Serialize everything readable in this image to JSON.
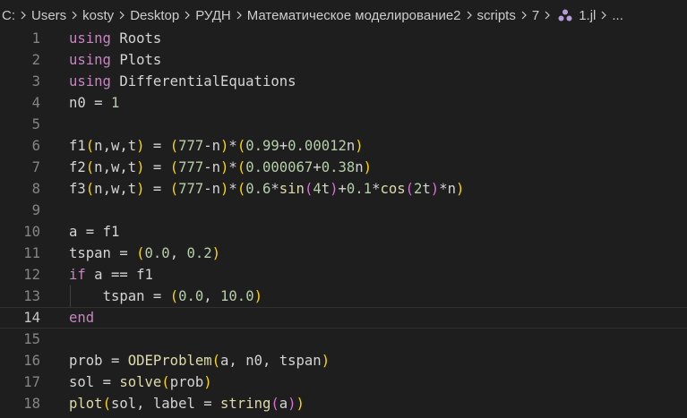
{
  "breadcrumb": {
    "items": [
      {
        "label": "C:",
        "name": "breadcrumb-drive"
      },
      {
        "label": "Users",
        "name": "breadcrumb-users"
      },
      {
        "label": "kosty",
        "name": "breadcrumb-kosty"
      },
      {
        "label": "Desktop",
        "name": "breadcrumb-desktop"
      },
      {
        "label": "РУДН",
        "name": "breadcrumb-rudn"
      },
      {
        "label": "Математическое моделирование2",
        "name": "breadcrumb-math-modeling"
      },
      {
        "label": "scripts",
        "name": "breadcrumb-scripts"
      },
      {
        "label": "7",
        "name": "breadcrumb-7"
      }
    ],
    "file_icon": "julia-file-icon",
    "file": "1.jl",
    "trailing": "..."
  },
  "editor": {
    "current_line": 14,
    "lines": [
      {
        "n": "1",
        "text": "using Roots"
      },
      {
        "n": "2",
        "text": "using Plots"
      },
      {
        "n": "3",
        "text": "using DifferentialEquations"
      },
      {
        "n": "4",
        "text": "n0 = 1"
      },
      {
        "n": "5",
        "text": ""
      },
      {
        "n": "6",
        "text": "f1(n,w,t) = (777-n)*(0.99+0.00012n)"
      },
      {
        "n": "7",
        "text": "f2(n,w,t) = (777-n)*(0.000067+0.38n)"
      },
      {
        "n": "8",
        "text": "f3(n,w,t) = (777-n)*(0.6*sin(4t)+0.1*cos(2t)*n)"
      },
      {
        "n": "9",
        "text": ""
      },
      {
        "n": "10",
        "text": "a = f1"
      },
      {
        "n": "11",
        "text": "tspan = (0.0, 0.2)"
      },
      {
        "n": "12",
        "text": "if a == f1"
      },
      {
        "n": "13",
        "text": "    tspan = (0.0, 10.0)"
      },
      {
        "n": "14",
        "text": "end"
      },
      {
        "n": "15",
        "text": ""
      },
      {
        "n": "16",
        "text": "prob = ODEProblem(a, n0, tspan)"
      },
      {
        "n": "17",
        "text": "sol = solve(prob)"
      },
      {
        "n": "18",
        "text": "plot(sol, label = string(a))"
      }
    ]
  },
  "colors": {
    "background": "#1e1e1e",
    "text": "#d4d4d4",
    "keyword": "#c586c0",
    "number": "#b5cea8",
    "bracket_gold": "#ffd700",
    "bracket_orchid": "#da70d6",
    "function": "#dcdcaa",
    "line_number": "#858585",
    "line_number_active": "#c6c6c6"
  }
}
